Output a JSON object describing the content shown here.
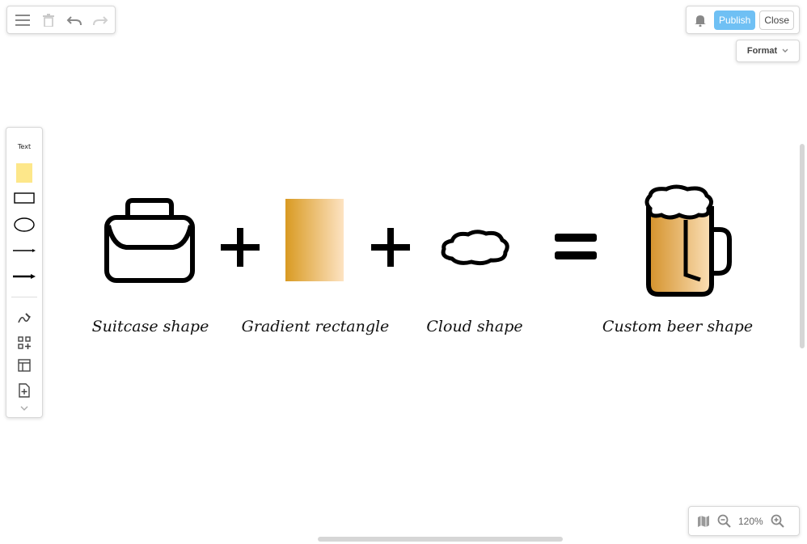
{
  "toolbar": {
    "menu_icon": "menu-icon",
    "delete_icon": "trash-icon",
    "undo_icon": "undo-icon",
    "redo_icon": "redo-icon"
  },
  "header": {
    "notification_icon": "bell-icon",
    "publish_label": "Publish",
    "close_label": "Close",
    "format_label": "Format"
  },
  "shapes_toolbar": {
    "text_label": "Text",
    "items": [
      "text",
      "sticky-note",
      "rectangle",
      "ellipse",
      "line",
      "arrow",
      "freehand",
      "add-shape",
      "table",
      "insert-page",
      "more"
    ]
  },
  "canvas": {
    "captions": {
      "suitcase": "Suitcase shape",
      "gradient": "Gradient rectangle",
      "cloud": "Cloud shape",
      "beer": "Custom beer shape"
    },
    "gradient_colors": [
      "#d99a22",
      "#fde3c2"
    ],
    "beer_colors": [
      "#d4912a",
      "#fbe0b8"
    ]
  },
  "zoom": {
    "level": "120%",
    "map_icon": "map-icon",
    "zoom_out_icon": "zoom-out-icon",
    "zoom_in_icon": "zoom-in-icon"
  }
}
